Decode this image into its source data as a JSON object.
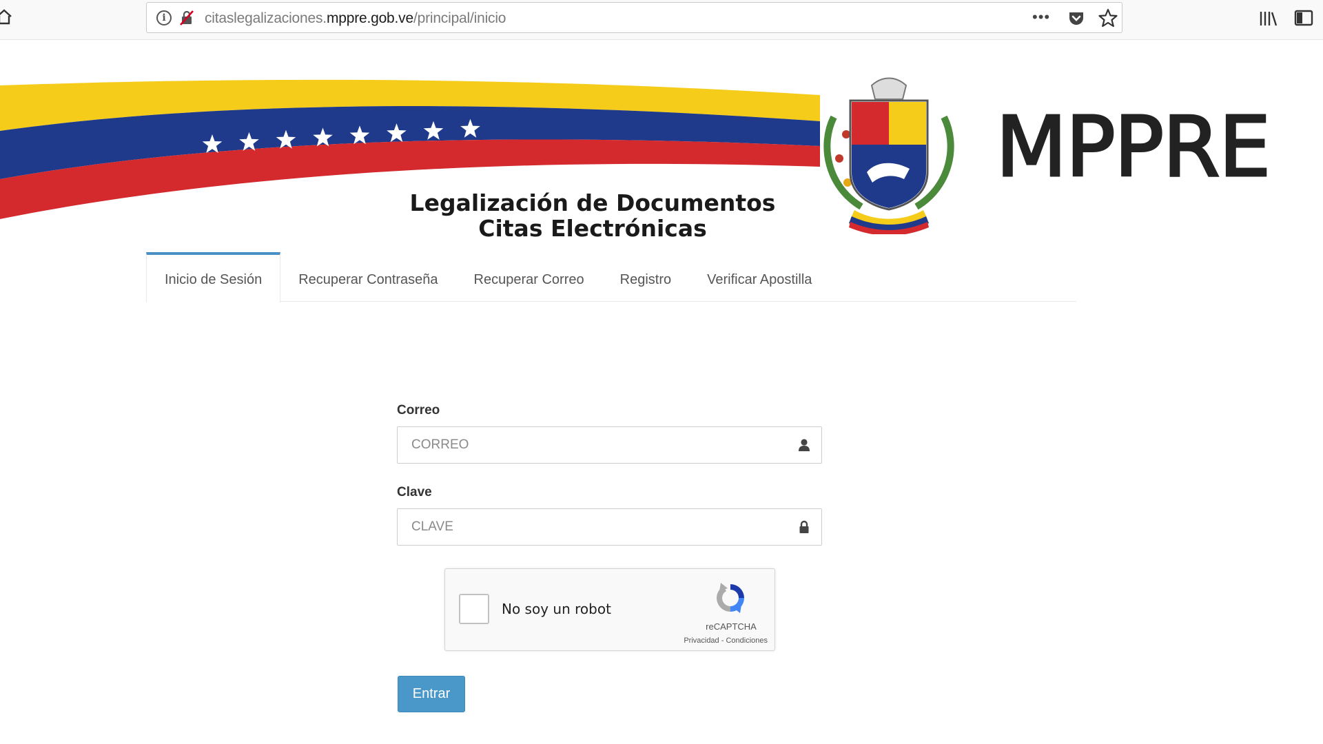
{
  "browser": {
    "url_prefix": "citaslegalizaciones.",
    "url_domain": "mppre.gob.ve",
    "url_path": "/principal/inicio",
    "more_label": "•••",
    "info_label": "i"
  },
  "banner": {
    "title_line1": "Legalización de Documentos",
    "title_line2": "Citas Electrónicas",
    "brand": "MPPRE",
    "flag_colors": {
      "yellow": "#f5cc1a",
      "blue": "#1f3a8a",
      "red": "#d42a2e"
    },
    "star_count": 8
  },
  "tabs": [
    {
      "label": "Inicio de Sesión",
      "active": true
    },
    {
      "label": "Recuperar Contraseña",
      "active": false
    },
    {
      "label": "Recuperar Correo",
      "active": false
    },
    {
      "label": "Registro",
      "active": false
    },
    {
      "label": "Verificar Apostilla",
      "active": false
    }
  ],
  "form": {
    "email_label": "Correo",
    "email_placeholder": "CORREO",
    "email_value": "",
    "email_icon": "user-icon",
    "password_label": "Clave",
    "password_placeholder": "CLAVE",
    "password_value": "",
    "password_icon": "lock-icon"
  },
  "captcha": {
    "label": "No soy un robot",
    "checked": false,
    "brand": "reCAPTCHA",
    "privacy": "Privacidad",
    "separator": " - ",
    "terms": "Condiciones"
  },
  "submit": {
    "label": "Entrar",
    "color": "#4a97c9"
  },
  "colors": {
    "tab_accent": "#4a90c4"
  }
}
